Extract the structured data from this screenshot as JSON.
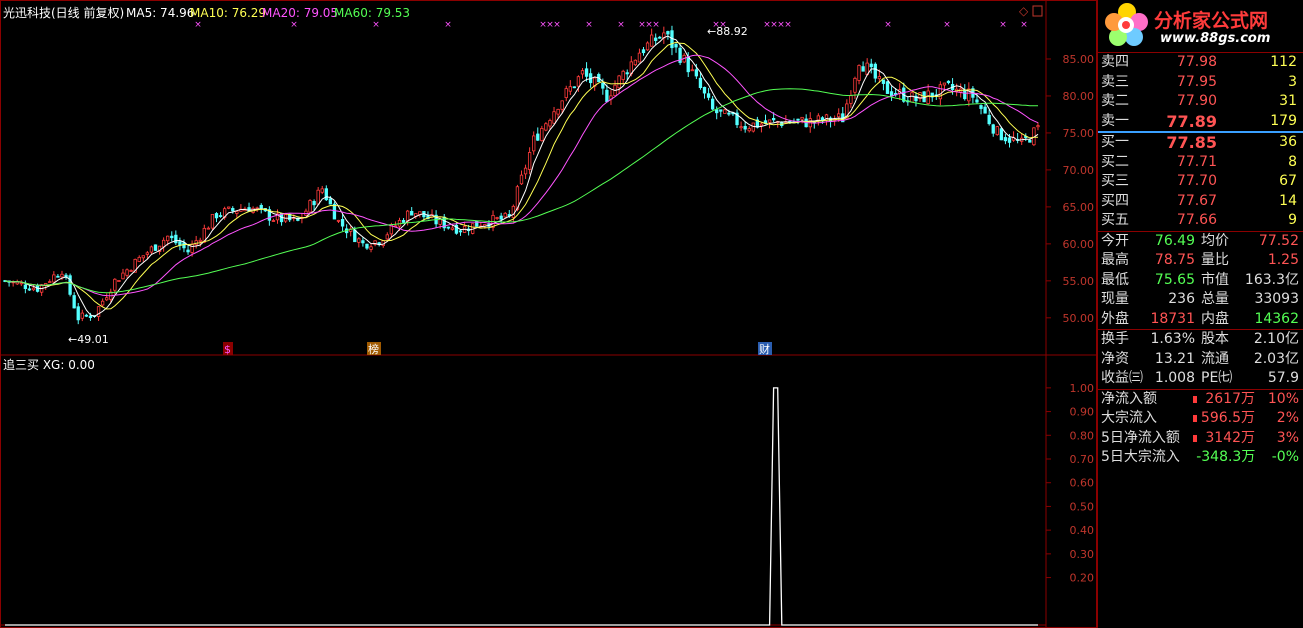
{
  "main_title": "光迅科技(日线 前复权)",
  "ma_legend": [
    {
      "label": "MA5: 74.96",
      "color": "#ffffff"
    },
    {
      "label": "MA10: 76.29",
      "color": "#ffff54"
    },
    {
      "label": "MA20: 79.05",
      "color": "#ff54ff"
    },
    {
      "label": "MA60: 79.53",
      "color": "#54ff54"
    }
  ],
  "indicator_title": "追三买  XG: 0.00",
  "markers": {
    "s": "$",
    "bang": "榜",
    "cai": "财"
  },
  "colors": {
    "up": "#ff3b3b",
    "down": "#54ffff",
    "grid": "#8b0000",
    "axis_text": "#c0362c"
  },
  "chart_data": [
    {
      "type": "candlestick",
      "ylim": [
        47,
        90
      ],
      "y_ticks": [
        "85.00",
        "80.00",
        "75.00",
        "70.00",
        "65.00",
        "60.00",
        "55.00",
        "50.00"
      ],
      "annotations": [
        "←49.01",
        "←88.92"
      ],
      "series": [
        {
          "name": "MA5"
        },
        {
          "name": "MA10"
        },
        {
          "name": "MA20"
        },
        {
          "name": "MA60"
        }
      ]
    },
    {
      "type": "line",
      "ylim": [
        0,
        1.05
      ],
      "y_ticks": [
        "1.00",
        "0.90",
        "0.80",
        "0.70",
        "0.60",
        "0.50",
        "0.40",
        "0.30",
        "0.20"
      ]
    }
  ],
  "panel": {
    "brand": "分析家公式网",
    "url": "www.88gs.com",
    "sell": [
      {
        "label": "卖四",
        "price": "77.98",
        "vol": "112"
      },
      {
        "label": "卖三",
        "price": "77.95",
        "vol": "3"
      },
      {
        "label": "卖二",
        "price": "77.90",
        "vol": "31"
      },
      {
        "label": "卖一",
        "price": "77.89",
        "vol": "179"
      }
    ],
    "buy": [
      {
        "label": "买一",
        "price": "77.85",
        "vol": "36"
      },
      {
        "label": "买二",
        "price": "77.71",
        "vol": "8"
      },
      {
        "label": "买三",
        "price": "77.70",
        "vol": "67"
      },
      {
        "label": "买四",
        "price": "77.67",
        "vol": "14"
      },
      {
        "label": "买五",
        "price": "77.66",
        "vol": "9"
      }
    ],
    "quote1": [
      {
        "k": "今开",
        "v": "76.49",
        "vc": "green",
        "k2": "均价",
        "v2": "77.52",
        "v2c": "red"
      },
      {
        "k": "最高",
        "v": "78.75",
        "vc": "red",
        "k2": "量比",
        "v2": "1.25",
        "v2c": "red"
      },
      {
        "k": "最低",
        "v": "75.65",
        "vc": "green",
        "k2": "市值",
        "v2": "163.3亿",
        "v2c": "white"
      },
      {
        "k": "现量",
        "v": "236",
        "vc": "white",
        "k2": "总量",
        "v2": "33093",
        "v2c": "white"
      },
      {
        "k": "外盘",
        "v": "18731",
        "vc": "red",
        "k2": "内盘",
        "v2": "14362",
        "v2c": "green"
      }
    ],
    "quote2": [
      {
        "k": "换手",
        "v": "1.63%",
        "vc": "white",
        "k2": "股本",
        "v2": "2.10亿",
        "v2c": "white"
      },
      {
        "k": "净资",
        "v": "13.21",
        "vc": "white",
        "k2": "流通",
        "v2": "2.03亿",
        "v2c": "white"
      },
      {
        "k": "收益㈢",
        "v": "1.008",
        "vc": "white",
        "k2": "PE㈦",
        "v2": "57.9",
        "v2c": "white"
      }
    ],
    "flows": [
      {
        "k": "净流入额",
        "v": "2617万",
        "p": "10%",
        "c": "red"
      },
      {
        "k": "大宗流入",
        "v": "596.5万",
        "p": "2%",
        "c": "red"
      },
      {
        "k": "5日净流入额",
        "v": "3142万",
        "p": "3%",
        "c": "red"
      },
      {
        "k": "5日大宗流入",
        "v": "-348.3万",
        "p": "-0%",
        "c": "green"
      }
    ]
  }
}
